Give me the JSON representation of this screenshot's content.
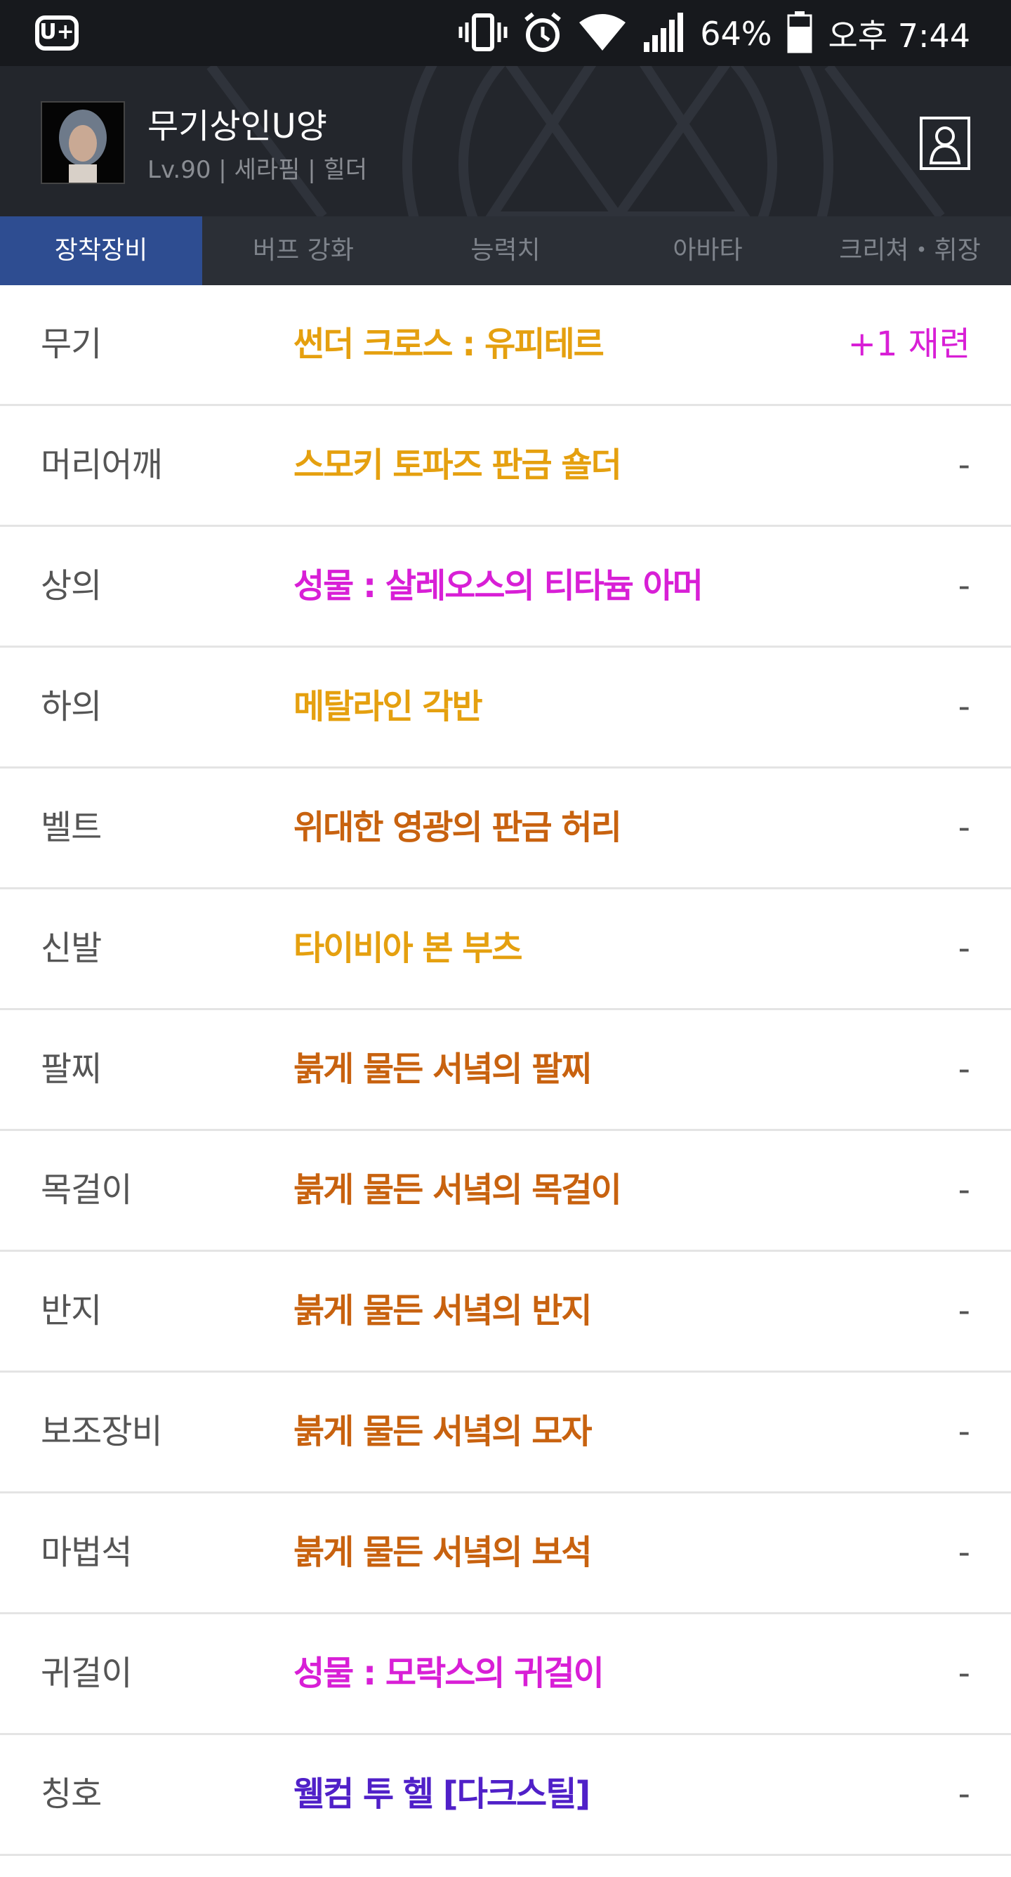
{
  "status_bar": {
    "carrier_logo": "U+",
    "battery": "64%",
    "time": "오후 7:44",
    "icons": [
      "vibrate-icon",
      "alarm-icon",
      "wifi-icon",
      "signal-icon",
      "battery-icon"
    ]
  },
  "profile": {
    "name": "무기상인U양",
    "subtitle": "Lv.90 | 세라핌 | 힐더",
    "profile_icon": "person-icon"
  },
  "tabs": [
    {
      "label": "장착장비",
      "active": true
    },
    {
      "label": "버프 강화",
      "active": false
    },
    {
      "label": "능력치",
      "active": false
    },
    {
      "label": "아바타",
      "active": false
    },
    {
      "label": "크리쳐・휘장",
      "active": false
    }
  ],
  "equipment": [
    {
      "slot": "무기",
      "item": "썬더 크로스 : 유피테르",
      "upgrade": "+1 재련",
      "color": "#e5a00f",
      "upgrade_color": "#d81fd6"
    },
    {
      "slot": "머리어깨",
      "item": "스모키 토파즈 판금 숄더",
      "upgrade": "-",
      "color": "#e5a00f"
    },
    {
      "slot": "상의",
      "item": "성물 : 살레오스의 티타늄 아머",
      "upgrade": "-",
      "color": "#d81fd6"
    },
    {
      "slot": "하의",
      "item": "메탈라인 각반",
      "upgrade": "-",
      "color": "#e5a00f"
    },
    {
      "slot": "벨트",
      "item": "위대한 영광의 판금 허리",
      "upgrade": "-",
      "color": "#c8620f"
    },
    {
      "slot": "신발",
      "item": "타이비아 본 부츠",
      "upgrade": "-",
      "color": "#e5a00f"
    },
    {
      "slot": "팔찌",
      "item": "붉게 물든 서녘의 팔찌",
      "upgrade": "-",
      "color": "#c8620f"
    },
    {
      "slot": "목걸이",
      "item": "붉게 물든 서녘의 목걸이",
      "upgrade": "-",
      "color": "#c8620f"
    },
    {
      "slot": "반지",
      "item": "붉게 물든 서녘의 반지",
      "upgrade": "-",
      "color": "#c8620f"
    },
    {
      "slot": "보조장비",
      "item": "붉게 물든 서녘의 모자",
      "upgrade": "-",
      "color": "#c8620f"
    },
    {
      "slot": "마법석",
      "item": "붉게 물든 서녘의 보석",
      "upgrade": "-",
      "color": "#c8620f"
    },
    {
      "slot": "귀걸이",
      "item": "성물 : 모락스의 귀걸이",
      "upgrade": "-",
      "color": "#d81fd6"
    },
    {
      "slot": "칭호",
      "item": "웰컴 투 헬 [다크스틸]",
      "upgrade": "-",
      "color": "#5020c8"
    }
  ]
}
